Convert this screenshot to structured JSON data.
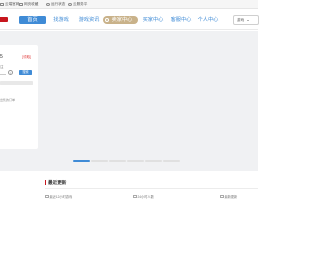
{
  "bookmarks": [
    {
      "label": "云端官网",
      "icon": "document-icon"
    },
    {
      "label": "网页收藏",
      "icon": "folder-icon"
    },
    {
      "label": "运行状态",
      "icon": "shield-icon"
    },
    {
      "label": "云服务平",
      "icon": "cloud-icon"
    }
  ],
  "nav": {
    "home": "首页",
    "find_game": "找游戏",
    "news": "游戏资讯",
    "sell_center": "卖家中心",
    "buy_center": "买家中心",
    "service_center": "客服中心",
    "personal_center": "个人中心",
    "account_select": "游戏"
  },
  "login_card": {
    "title": "5",
    "tag": "[领取]",
    "subtitle": "注",
    "clear_symbol": "×",
    "button_label": "搜索",
    "line_text": "出售的订单"
  },
  "carousel": {
    "slide_count": 6,
    "active_index": 0
  },
  "recent": {
    "title": "最近更新",
    "items": [
      {
        "label": "最近12小时游戏"
      },
      {
        "label": "24小时人数"
      },
      {
        "label": "最新更新"
      }
    ]
  },
  "colors": {
    "brand_blue": "#3f8bd6",
    "brand_red": "#c7161e",
    "sell_gold": "#c9b28a",
    "banner_bg": "#f0f1f3"
  }
}
